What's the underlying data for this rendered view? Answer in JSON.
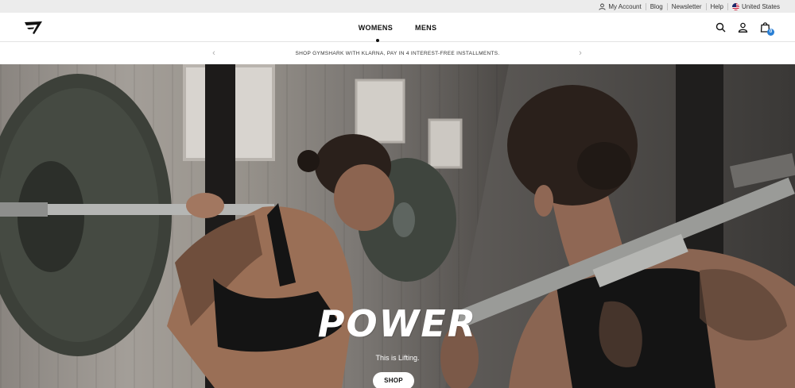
{
  "utility_bar": {
    "my_account": "My Account",
    "blog": "Blog",
    "newsletter": "Newsletter",
    "help": "Help",
    "region": "United States"
  },
  "header": {
    "logo_alt": "Gymshark logo",
    "nav": [
      "WOMENS",
      "MENS"
    ],
    "icons": [
      "search-icon",
      "account-icon",
      "bag-icon"
    ],
    "bag_count": "0"
  },
  "promo": {
    "text": "SHOP GYMSHARK WITH KLARNA, PAY IN 4 INTEREST-FREE INSTALLMENTS.",
    "prev": "‹",
    "next": "›"
  },
  "hero": {
    "title": "POWER",
    "subtitle": "This is Lifting.",
    "cta": "SHOP"
  },
  "colors": {
    "badge": "#2a7fd4",
    "utility_bg": "#ececec"
  }
}
